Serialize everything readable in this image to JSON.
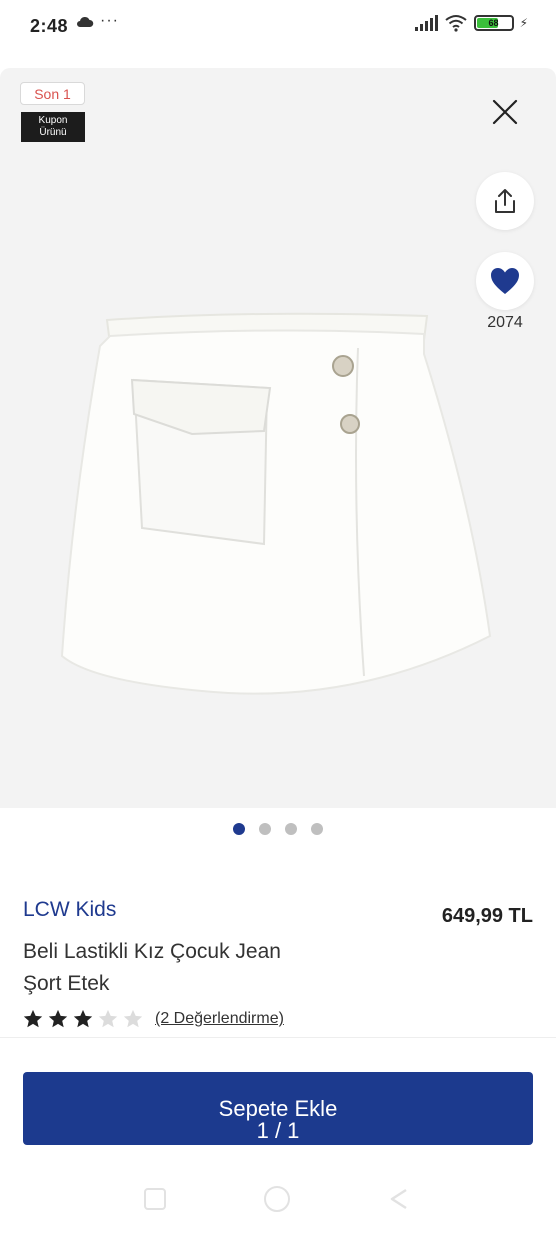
{
  "status_bar": {
    "time": "2:48",
    "icons": [
      "cloud-icon",
      "more-dots-icon",
      "signal-icon",
      "wifi-icon",
      "battery-icon",
      "charging-icon"
    ],
    "dots": "···",
    "battery": "68",
    "charge_glyph": "⚡"
  },
  "product_image": {
    "badge_last": "Son 1",
    "badge_coupon_line1": "Kupon",
    "badge_coupon_line2": "Ürünü",
    "favorite_count": "2074",
    "image_count": 4,
    "active_image": 1,
    "icons": [
      "close-icon",
      "share-icon",
      "heart-icon"
    ]
  },
  "product": {
    "brand": "LCW Kids",
    "price": "649,99 TL",
    "name": "Beli Lastikli Kız Çocuk Jean Şort Etek",
    "rating": 3,
    "rating_max": 5,
    "reviews_text": "(2 Değerlendirme)"
  },
  "cart_button": {
    "label": "Sepete Ekle",
    "count": "1 / 1"
  },
  "colors": {
    "accent": "#1c3a8e",
    "brand_text": "#1f3a8f",
    "badge_red": "#d9534f",
    "image_background": "#f3f3f3"
  }
}
